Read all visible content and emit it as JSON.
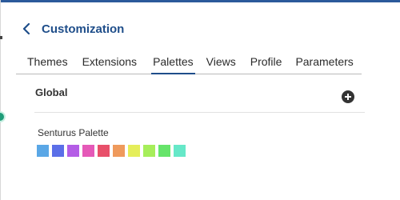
{
  "header": {
    "title": "Customization",
    "back_icon": "chevron-left-icon"
  },
  "tabs": [
    {
      "label": "Themes",
      "active": false
    },
    {
      "label": "Extensions",
      "active": false
    },
    {
      "label": "Palettes",
      "active": true
    },
    {
      "label": "Views",
      "active": false
    },
    {
      "label": "Profile",
      "active": false
    },
    {
      "label": "Parameters",
      "active": false
    }
  ],
  "section": {
    "title": "Global",
    "add_icon": "plus-circle-icon"
  },
  "palette": {
    "name": "Senturus Palette",
    "colors": [
      "#5aa7e6",
      "#5b6fe8",
      "#b45de6",
      "#e559b8",
      "#e8506a",
      "#ef9a5c",
      "#e5ee5a",
      "#a6ee5a",
      "#66e46a",
      "#66e8c8"
    ]
  },
  "accent": "#1f4e8a"
}
